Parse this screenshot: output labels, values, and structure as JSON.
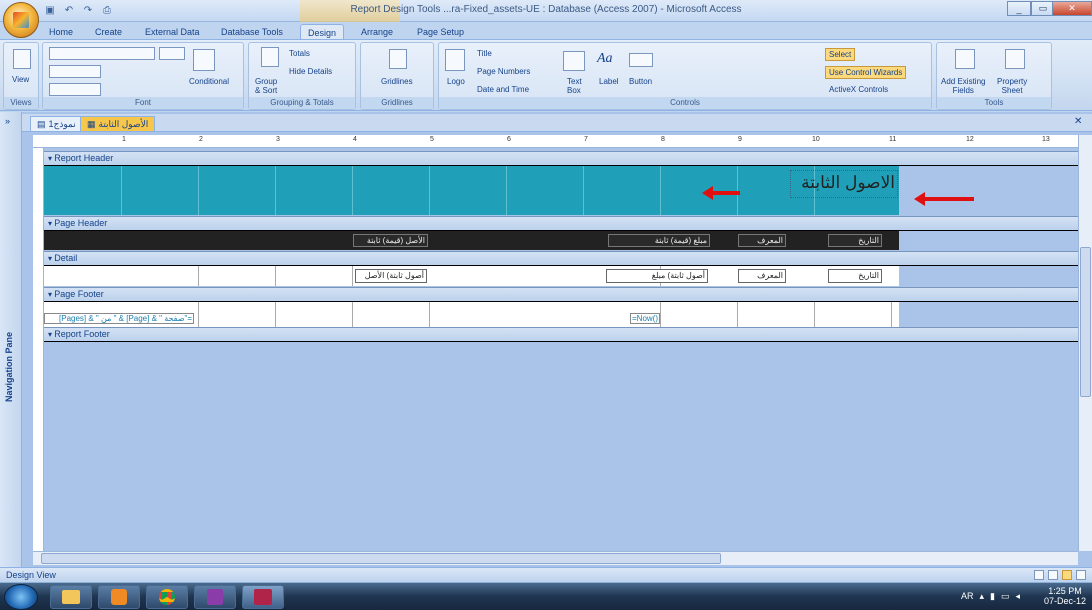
{
  "window": {
    "title": "Report Design Tools     ...ra-Fixed_assets-UE : Database (Access 2007) - Microsoft Access",
    "context_title": "Report Design Tools"
  },
  "qat": {
    "items": [
      "save-icon",
      "undo-icon",
      "redo-icon",
      "print-preview-icon"
    ]
  },
  "ribbon_tabs": [
    "Home",
    "Create",
    "External Data",
    "Database Tools",
    "Design",
    "Arrange",
    "Page Setup"
  ],
  "active_tab": "Design",
  "groups": {
    "views": {
      "label": "Views",
      "view_label": "View"
    },
    "font": {
      "label": "Font",
      "conditional_label": "Conditional"
    },
    "grouping": {
      "label": "Grouping & Totals",
      "group_sort": "Group\n& Sort",
      "totals": "Totals",
      "hide_details": "Hide Details"
    },
    "gridlines": {
      "label": "Gridlines",
      "gridlines": "Gridlines"
    },
    "controls": {
      "label": "Controls",
      "logo": "Logo",
      "title": "Title",
      "page_numbers": "Page Numbers",
      "date_time": "Date and Time",
      "text_box": "Text\nBox",
      "label_btn": "Label",
      "button": "Button",
      "select": "Select",
      "use_wizards": "Use Control Wizards",
      "activex": "ActiveX Controls"
    },
    "tools": {
      "label": "Tools",
      "add_fields": "Add Existing\nFields",
      "property_sheet": "Property\nSheet"
    }
  },
  "doc_tabs": [
    "نموذج1",
    "الأصول الثابتة"
  ],
  "active_doc_tab": "الأصول الثابتة",
  "nav_pane_label": "Navigation Pane",
  "sections": {
    "report_header": "Report Header",
    "page_header": "Page Header",
    "detail": "Detail",
    "page_footer": "Page Footer",
    "report_footer": "Report Footer"
  },
  "report_title": "الاصول الثابتة",
  "page_header_labels": [
    "التاريخ",
    "المعرف",
    "مبلغ (قيمة) ثابتة",
    "الأصل (قيمة) ثابتة"
  ],
  "detail_fields": [
    "التاريخ",
    "المعرف",
    "أصول ثابتة) مبلغ",
    "أصول ثابتة) الأصل"
  ],
  "page_footer_text": "=\"صفحة \" & [Page] & \" من \" & [Pages]",
  "page_footer_now": "=Now()",
  "ruler_numbers": [
    "1",
    "2",
    "3",
    "4",
    "5",
    "6",
    "7",
    "8",
    "9",
    "10",
    "11",
    "12",
    "13"
  ],
  "status": {
    "left": "Design View"
  },
  "taskbar": {
    "apps": [
      "explorer-icon",
      "media-player-icon",
      "chrome-icon",
      "onenote-icon",
      "access-icon"
    ],
    "lang": "AR",
    "time": "1:25 PM",
    "date": "07-Dec-12"
  },
  "colors": {
    "accent": "#f7c74c",
    "report_header_fill": "#1fa0b8",
    "arrow": "#e01010"
  }
}
